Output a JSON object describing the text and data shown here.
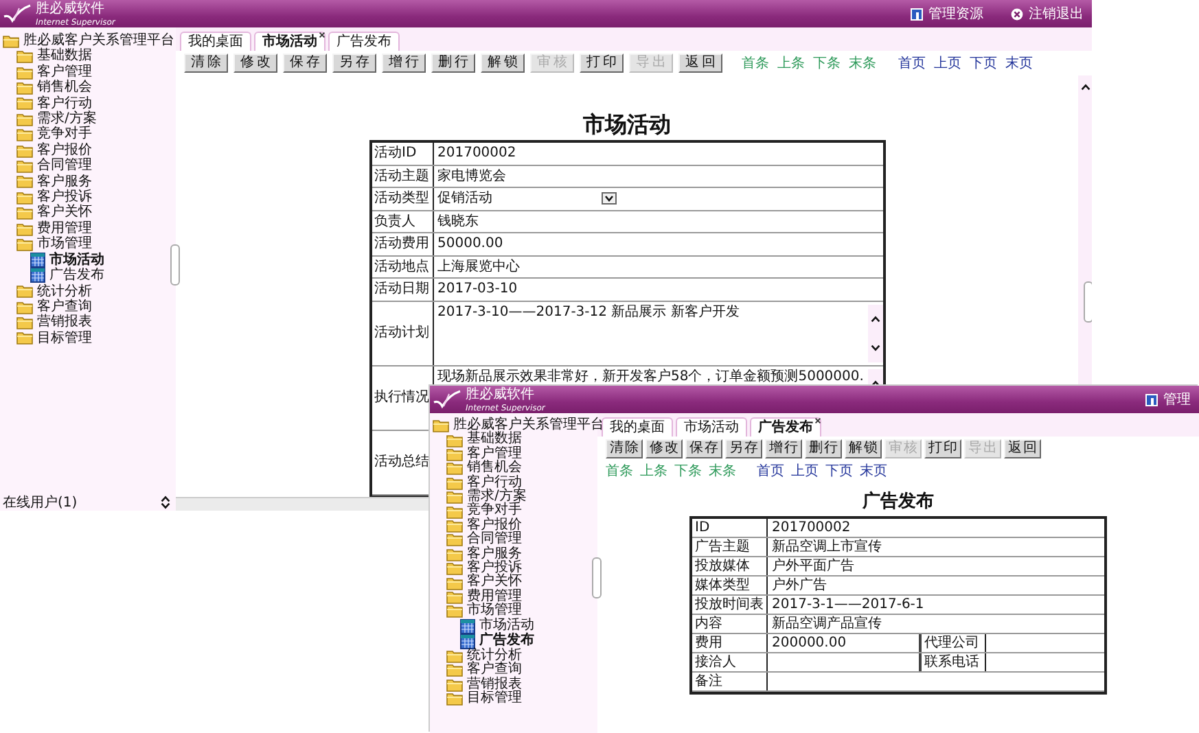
{
  "windows": [
    {
      "brand": {
        "name": "胜必威软件",
        "tagline": "Internet Supervisor"
      },
      "header_links": [
        {
          "label": "管理资源",
          "kind": "resources"
        },
        {
          "label": "注销退出",
          "kind": "logout"
        }
      ],
      "tree": {
        "label": "胜必威客户关系管理平台",
        "kind": "folder",
        "selected": false,
        "children": [
          {
            "label": "基础数据",
            "kind": "folder",
            "selected": false
          },
          {
            "label": "客户管理",
            "kind": "folder",
            "selected": false
          },
          {
            "label": "销售机会",
            "kind": "folder",
            "selected": false
          },
          {
            "label": "客户行动",
            "kind": "folder",
            "selected": false
          },
          {
            "label": "需求/方案",
            "kind": "folder",
            "selected": false
          },
          {
            "label": "竞争对手",
            "kind": "folder",
            "selected": false
          },
          {
            "label": "客户报价",
            "kind": "folder",
            "selected": false
          },
          {
            "label": "合同管理",
            "kind": "folder",
            "selected": false
          },
          {
            "label": "客户服务",
            "kind": "folder",
            "selected": false
          },
          {
            "label": "客户投诉",
            "kind": "folder",
            "selected": false
          },
          {
            "label": "客户关怀",
            "kind": "folder",
            "selected": false
          },
          {
            "label": "费用管理",
            "kind": "folder",
            "selected": false
          },
          {
            "label": "市场管理",
            "kind": "folder",
            "selected": false,
            "children": [
              {
                "label": "市场活动",
                "kind": "page",
                "selected": true
              },
              {
                "label": "广告发布",
                "kind": "page",
                "selected": false
              }
            ]
          },
          {
            "label": "统计分析",
            "kind": "folder",
            "selected": false
          },
          {
            "label": "客户查询",
            "kind": "folder",
            "selected": false
          },
          {
            "label": "营销报表",
            "kind": "folder",
            "selected": false
          },
          {
            "label": "目标管理",
            "kind": "folder",
            "selected": false
          }
        ]
      },
      "online_users": "在线用户(1)",
      "tabs": [
        {
          "label": "我的桌面",
          "selected": false
        },
        {
          "label": "市场活动",
          "selected": true
        },
        {
          "label": "广告发布",
          "selected": false
        }
      ],
      "toolbar": [
        {
          "label": "清除",
          "disabled": false
        },
        {
          "label": "修改",
          "disabled": false
        },
        {
          "label": "保存",
          "disabled": false
        },
        {
          "label": "另存",
          "disabled": false
        },
        {
          "label": "增行",
          "disabled": false
        },
        {
          "label": "删行",
          "disabled": false
        },
        {
          "label": "解锁",
          "disabled": false
        },
        {
          "label": "审核",
          "disabled": true
        },
        {
          "label": "打印",
          "disabled": false
        },
        {
          "label": "导出",
          "disabled": true
        },
        {
          "label": "返回",
          "disabled": false
        }
      ],
      "nav_links": [
        {
          "label": "首条",
          "color": "#2e9a5a"
        },
        {
          "label": "上条",
          "color": "#2e9a5a"
        },
        {
          "label": "下条",
          "color": "#2e9a5a"
        },
        {
          "label": "末条",
          "color": "#2e9a5a"
        },
        {
          "label": "首页",
          "color": "#22349a"
        },
        {
          "label": "上页",
          "color": "#22349a"
        },
        {
          "label": "下页",
          "color": "#22349a"
        },
        {
          "label": "末页",
          "color": "#22349a"
        }
      ],
      "form": {
        "title": "市场活动",
        "rows": [
          {
            "kind": "text",
            "label": "活动ID",
            "value": "201700002"
          },
          {
            "kind": "text",
            "label": "活动主题",
            "value": "家电博览会"
          },
          {
            "kind": "select",
            "label": "活动类型",
            "value": "促销活动"
          },
          {
            "kind": "text",
            "label": "负责人",
            "value": "钱晓东"
          },
          {
            "kind": "text",
            "label": "活动费用",
            "value": "50000.00"
          },
          {
            "kind": "text",
            "label": "活动地点",
            "value": "上海展览中心"
          },
          {
            "kind": "text",
            "label": "活动日期",
            "value": "2017-03-10"
          },
          {
            "kind": "memo",
            "label": "活动计划",
            "value": "2017-3-10——2017-3-12  新品展示  新客户开发"
          },
          {
            "kind": "memo",
            "label": "执行情况",
            "value": "现场新品展示效果非常好，新开发客户58个，订单金额预测5000000."
          },
          {
            "kind": "memo",
            "label": "活动总结"
          }
        ]
      }
    },
    {
      "brand": {
        "name": "胜必威软件",
        "tagline": "Internet Supervisor"
      },
      "header_links": [
        {
          "label": "管理",
          "kind": "resources"
        }
      ],
      "tree": {
        "label": "胜必威客户关系管理平台",
        "kind": "folder",
        "selected": false,
        "children": [
          {
            "label": "基础数据",
            "kind": "folder",
            "selected": false
          },
          {
            "label": "客户管理",
            "kind": "folder",
            "selected": false
          },
          {
            "label": "销售机会",
            "kind": "folder",
            "selected": false
          },
          {
            "label": "客户行动",
            "kind": "folder",
            "selected": false
          },
          {
            "label": "需求/方案",
            "kind": "folder",
            "selected": false
          },
          {
            "label": "竞争对手",
            "kind": "folder",
            "selected": false
          },
          {
            "label": "客户报价",
            "kind": "folder",
            "selected": false
          },
          {
            "label": "合同管理",
            "kind": "folder",
            "selected": false
          },
          {
            "label": "客户服务",
            "kind": "folder",
            "selected": false
          },
          {
            "label": "客户投诉",
            "kind": "folder",
            "selected": false
          },
          {
            "label": "客户关怀",
            "kind": "folder",
            "selected": false
          },
          {
            "label": "费用管理",
            "kind": "folder",
            "selected": false
          },
          {
            "label": "市场管理",
            "kind": "folder",
            "selected": false,
            "children": [
              {
                "label": "市场活动",
                "kind": "page",
                "selected": false
              },
              {
                "label": "广告发布",
                "kind": "page",
                "selected": true
              }
            ]
          },
          {
            "label": "统计分析",
            "kind": "folder",
            "selected": false
          },
          {
            "label": "客户查询",
            "kind": "folder",
            "selected": false
          },
          {
            "label": "营销报表",
            "kind": "folder",
            "selected": false
          },
          {
            "label": "目标管理",
            "kind": "folder",
            "selected": false
          }
        ]
      },
      "tabs": [
        {
          "label": "我的桌面",
          "selected": false
        },
        {
          "label": "市场活动",
          "selected": false
        },
        {
          "label": "广告发布",
          "selected": true
        }
      ],
      "toolbar": [
        {
          "label": "清除",
          "disabled": false
        },
        {
          "label": "修改",
          "disabled": false
        },
        {
          "label": "保存",
          "disabled": false
        },
        {
          "label": "另存",
          "disabled": false
        },
        {
          "label": "增行",
          "disabled": false
        },
        {
          "label": "删行",
          "disabled": false
        },
        {
          "label": "解锁",
          "disabled": false
        },
        {
          "label": "审核",
          "disabled": true
        },
        {
          "label": "打印",
          "disabled": false
        },
        {
          "label": "导出",
          "disabled": true
        },
        {
          "label": "返回",
          "disabled": false
        }
      ],
      "nav_links": [
        {
          "label": "首条",
          "color": "#2e9a5a"
        },
        {
          "label": "上条",
          "color": "#2e9a5a"
        },
        {
          "label": "下条",
          "color": "#2e9a5a"
        },
        {
          "label": "末条",
          "color": "#2e9a5a"
        },
        {
          "label": "首页",
          "color": "#22349a"
        },
        {
          "label": "上页",
          "color": "#22349a"
        },
        {
          "label": "下页",
          "color": "#22349a"
        },
        {
          "label": "末页",
          "color": "#22349a"
        }
      ],
      "form": {
        "title": "广告发布",
        "rows": [
          {
            "kind": "text",
            "label": "ID",
            "value": "201700002"
          },
          {
            "kind": "text",
            "label": "广告主题",
            "value": "新品空调上市宣传"
          },
          {
            "kind": "text",
            "label": "投放媒体",
            "value": "户外平面广告"
          },
          {
            "kind": "text",
            "label": "媒体类型",
            "value": "户外广告"
          },
          {
            "kind": "text",
            "label": "投放时间表",
            "value": "2017-3-1——2017-6-1"
          },
          {
            "kind": "text",
            "label": "内容",
            "value": "新品空调产品宣传"
          },
          {
            "kind": "pair",
            "label": "费用",
            "value": "200000.00",
            "label2": "代理公司"
          },
          {
            "kind": "pair",
            "label": "接洽人",
            "label2": "联系电话"
          },
          {
            "kind": "text",
            "label": "备注"
          }
        ]
      }
    }
  ]
}
